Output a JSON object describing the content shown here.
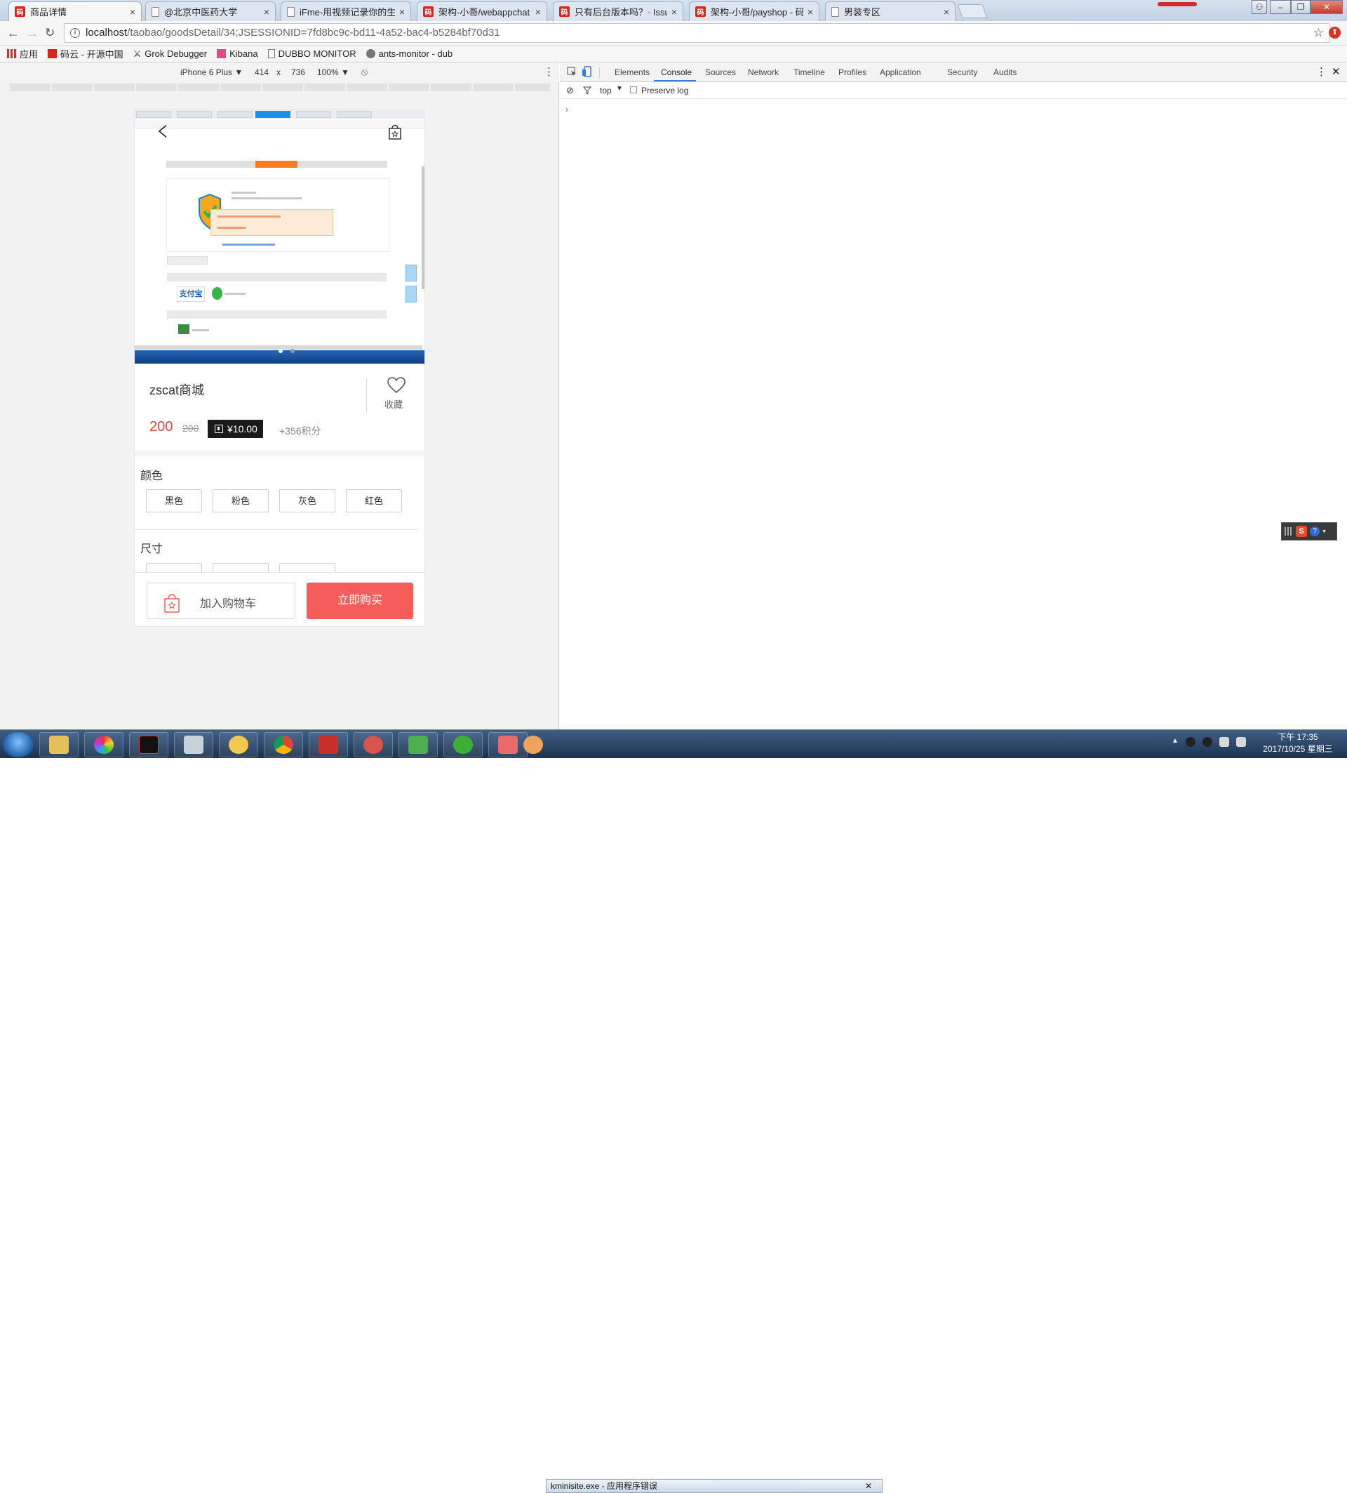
{
  "browser": {
    "tabs": [
      {
        "title": "商品详情",
        "favicon": "red-logo",
        "active": true
      },
      {
        "title": "@北京中医药大学",
        "favicon": "doc"
      },
      {
        "title": "iFme-用视频记录你的生",
        "favicon": "doc"
      },
      {
        "title": "架构-小哥/webappchat",
        "favicon": "red-logo"
      },
      {
        "title": "只有后台版本吗？· Issu",
        "favicon": "red-logo"
      },
      {
        "title": "架构-小哥/payshop - 码",
        "favicon": "red-logo"
      },
      {
        "title": "男装专区",
        "favicon": "doc"
      }
    ],
    "url_host": "localhost",
    "url_path": "/taobao/goodsDetail/34;JSESSIONID=7fd8bc9c-bd11-4a52-bac4-b5284bf70d31",
    "bookmarks": [
      "应用",
      "码云 - 开源中国",
      "Grok Debugger",
      "Kibana",
      "DUBBO MONITOR",
      "ants-monitor - dub"
    ]
  },
  "device_toolbar": {
    "device": "iPhone 6 Plus ▼",
    "width": "414",
    "x": "x",
    "height": "736",
    "zoom": "100% ▼"
  },
  "product": {
    "name": "zscat商城",
    "fav_label": "收藏",
    "price": "200",
    "old_price": "200",
    "coupon": "¥10.00",
    "points": "+356积分",
    "color_title": "颜色",
    "colors": [
      "黑色",
      "粉色",
      "灰色",
      "红色"
    ],
    "size_title": "尺寸",
    "add_cart": "加入购物车",
    "buy_now": "立即购买"
  },
  "devtools": {
    "tabs": [
      "Elements",
      "Console",
      "Sources",
      "Network",
      "Timeline",
      "Profiles",
      "Application",
      "Security",
      "Audits"
    ],
    "active_tab": "Console",
    "context": "top",
    "preserve_log": "Preserve log",
    "prompt": "›"
  },
  "taskbar": {
    "tooltip": "kminisite.exe - 应用程序错误",
    "time": "下午 17:35",
    "date": "2017/10/25 星期三"
  },
  "colors": {
    "accent_red": "#f55c5a",
    "price_red": "#e64340",
    "devtools_blue": "#3879d9"
  }
}
